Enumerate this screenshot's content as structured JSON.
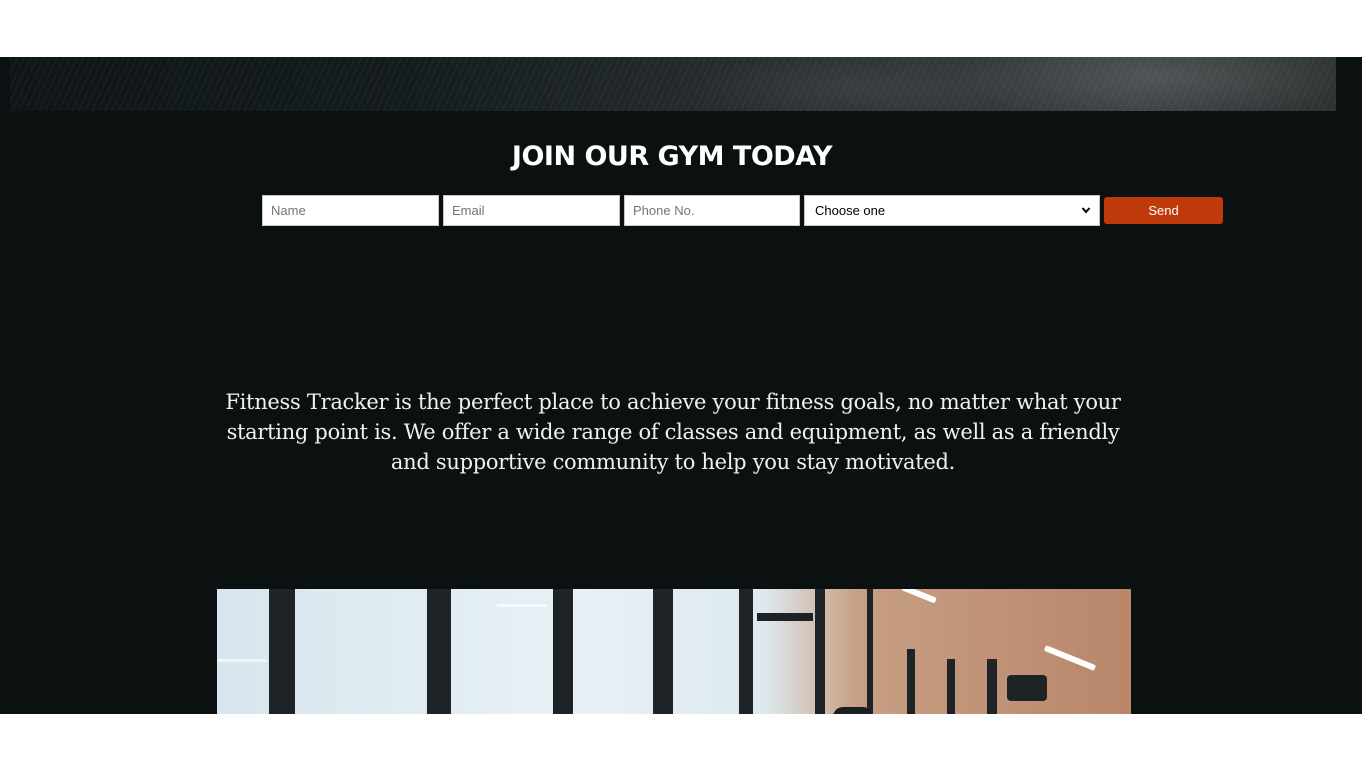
{
  "signup": {
    "title": "JOIN OUR GYM TODAY",
    "name_placeholder": "Name",
    "email_placeholder": "Email",
    "phone_placeholder": "Phone No.",
    "select_value": "Choose one",
    "send_label": "Send"
  },
  "about": {
    "text": "Fitness Tracker is the perfect place to achieve your fitness goals, no matter what your starting point is. We offer a wide range of classes and equipment, as well as a friendly and supportive community to help you stay motivated."
  },
  "icons": {
    "select_chevron": "chevron-down-icon"
  },
  "colors": {
    "page_background": "#0b1011",
    "send_button": "#bf3a0a",
    "title_text": "#ffffff"
  }
}
